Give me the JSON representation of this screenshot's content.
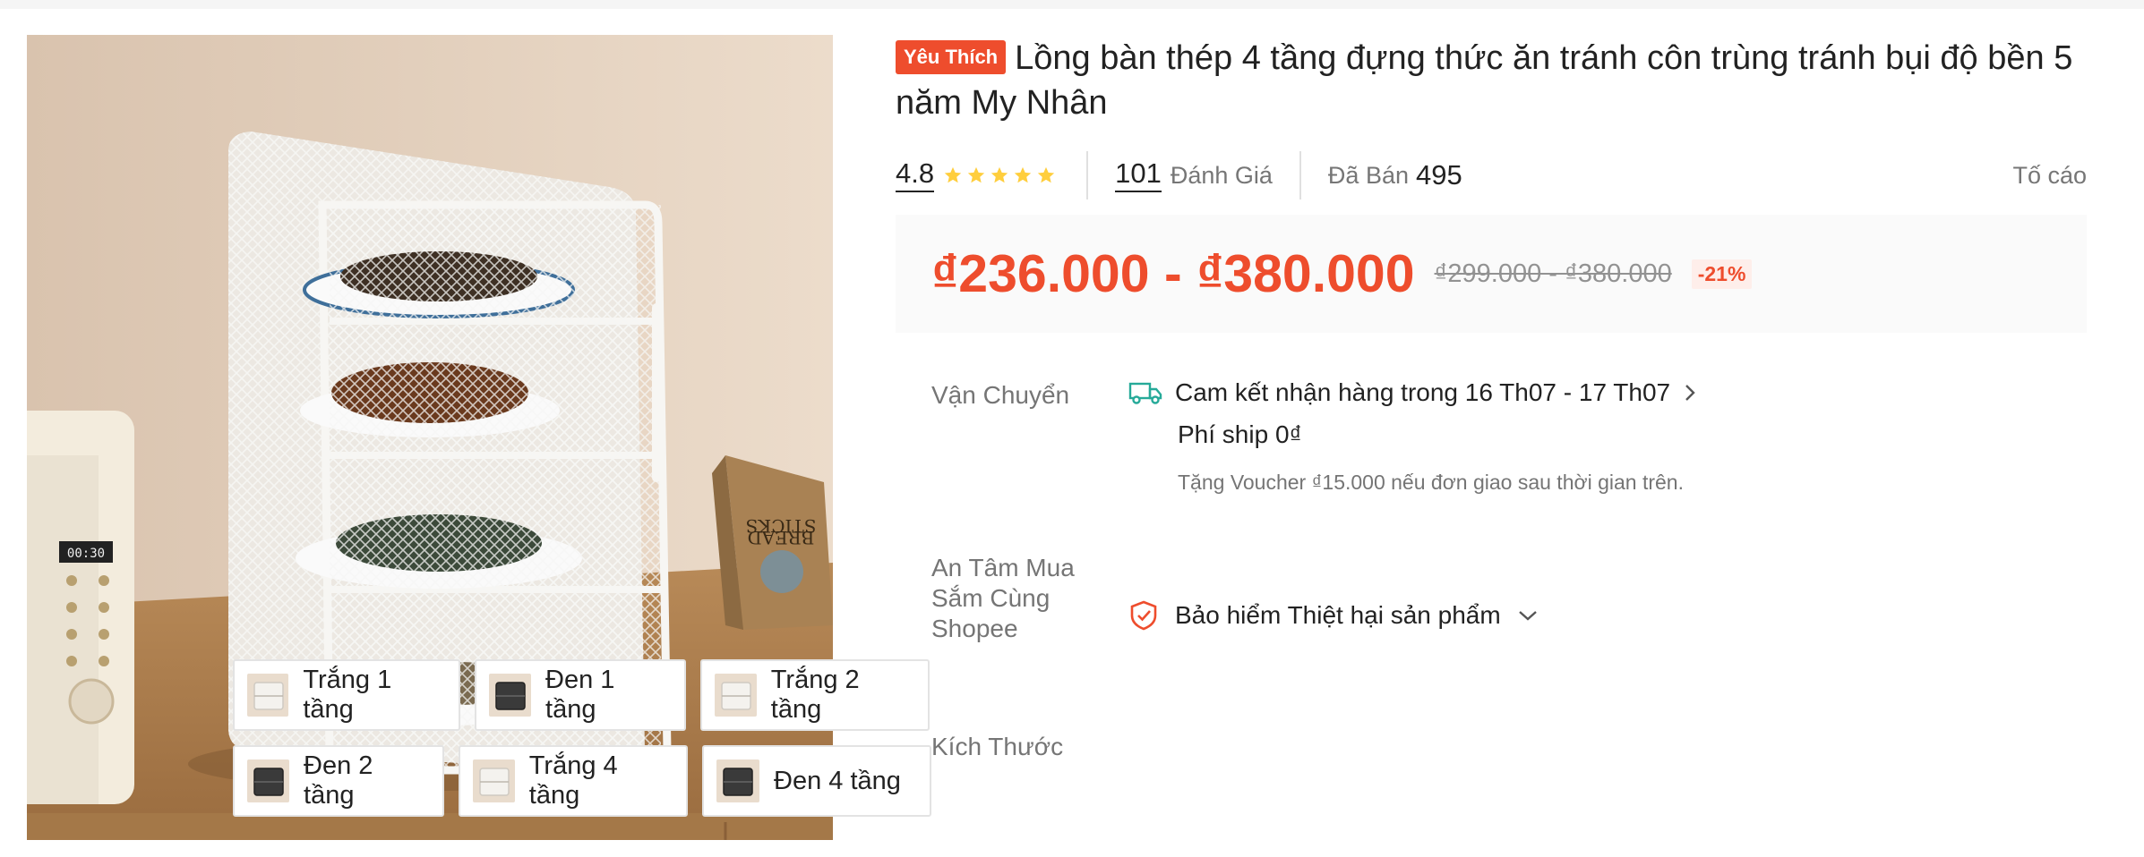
{
  "product": {
    "badge": "Yêu Thích",
    "title": "Lồng bàn thép 4 tầng đựng thức ăn tránh côn trùng tránh bụi độ bền 5 năm My Nhân"
  },
  "stats": {
    "rating": "4.8",
    "stars": 5,
    "reviews_count": "101",
    "reviews_label": "Đánh Giá",
    "sold_label": "Đã Bán",
    "sold_count": "495",
    "report_label": "Tố cáo"
  },
  "price": {
    "current": "₫236.000 - ₫380.000",
    "original": "₫299.000 - ₫380.000",
    "discount": "-21%"
  },
  "shipping": {
    "label": "Vận Chuyển",
    "delivery": "Cam kết nhận hàng trong 16 Th07 - 17 Th07",
    "fee": "Phí ship 0₫",
    "voucher_note": "Tặng Voucher ₫15.000 nếu đơn giao sau thời gian trên."
  },
  "guarantee": {
    "label_line1": "An Tâm Mua",
    "label_line2": "Sắm Cùng",
    "label_line3": "Shopee",
    "value": "Bảo hiểm Thiệt hại sản phẩm"
  },
  "size": {
    "label": "Kích Thước",
    "options": [
      {
        "label": "Trắng 1 tầng",
        "color": "white"
      },
      {
        "label": "Đen 1 tầng",
        "color": "black"
      },
      {
        "label": "Trắng 2 tầng",
        "color": "white"
      },
      {
        "label": "Đen 2 tầng",
        "color": "black"
      },
      {
        "label": "Trắng 4 tầng",
        "color": "white"
      },
      {
        "label": "Đen 4 tầng",
        "color": "black"
      }
    ]
  },
  "image": {
    "microwave_display": "00:30",
    "bag_text_line1": "BREAD",
    "bag_text_line2": "STICKS"
  },
  "colors": {
    "accent": "#ee4d2d",
    "star": "#ffce3d",
    "teal": "#26aa99"
  },
  "icons": [
    "star-icon",
    "truck-icon",
    "chevron-right-icon",
    "shield-icon",
    "chevron-down-icon"
  ]
}
